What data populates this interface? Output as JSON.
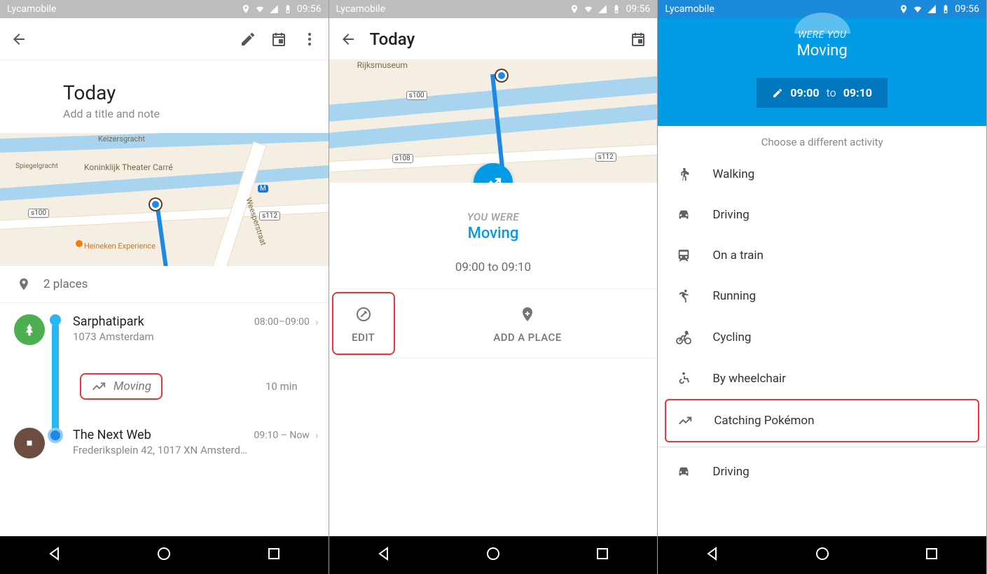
{
  "status": {
    "carrier": "Lycamobile",
    "time": "09:56"
  },
  "screen1": {
    "today": "Today",
    "subtitle": "Add a title and note",
    "places_count": "2 places",
    "map": {
      "labels": {
        "keizersgracht": "Keizersgracht",
        "theater": "Koninklijk Theater Carré",
        "spiegelgracht": "Spiegelgracht",
        "heineken": "Heineken Experience",
        "weesperstraat": "Weesperstraat"
      },
      "badges": {
        "s100": "s100",
        "s112": "s112",
        "m": "M"
      }
    },
    "items": [
      {
        "name": "Sarphatipark",
        "time": "08:00–09:00",
        "sub": "1073 Amsterdam"
      },
      {
        "name": "The Next Web",
        "time": "09:10 – Now",
        "sub": "Frederiksplein 42, 1017 XN Amsterd…"
      }
    ],
    "moving": {
      "label": "Moving",
      "duration": "10 min"
    }
  },
  "screen2": {
    "title": "Today",
    "map": {
      "labels": {
        "rijksmuseum": "Rijksmuseum"
      },
      "badges": {
        "s100": "s100",
        "s108": "s108",
        "s112": "s112"
      }
    },
    "you_were": "YOU WERE",
    "moving": "Moving",
    "range": "09:00 to 09:10",
    "edit": "EDIT",
    "add_place": "ADD A PLACE"
  },
  "screen3": {
    "you_were": "WERE YOU",
    "moving": "Moving",
    "time_from": "09:00",
    "time_to_word": "to",
    "time_to": "09:10",
    "choose": "Choose a different activity",
    "activities": [
      "Walking",
      "Driving",
      "On a train",
      "Running",
      "Cycling",
      "By wheelchair",
      "Catching Pokémon"
    ],
    "extra": "Driving"
  }
}
